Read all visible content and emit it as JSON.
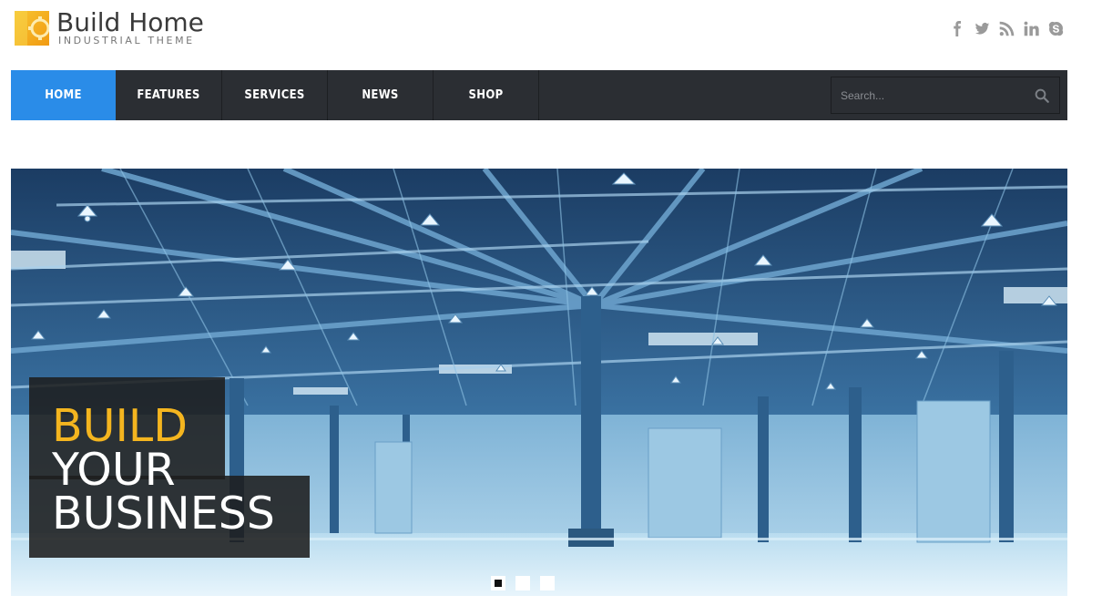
{
  "brand": {
    "title": "Build Home",
    "subtitle": "INDUSTRIAL THEME",
    "accent": "#f4b51f"
  },
  "social": [
    {
      "icon": "facebook-icon"
    },
    {
      "icon": "twitter-icon"
    },
    {
      "icon": "rss-icon"
    },
    {
      "icon": "linkedin-icon"
    },
    {
      "icon": "skype-icon"
    }
  ],
  "nav": {
    "items": [
      {
        "label": "HOME",
        "active": true
      },
      {
        "label": "FEATURES",
        "active": false
      },
      {
        "label": "SERVICES",
        "active": false
      },
      {
        "label": "NEWS",
        "active": false
      },
      {
        "label": "SHOP",
        "active": false
      }
    ],
    "active_color": "#2a8ce8",
    "search": {
      "placeholder": "Search...",
      "value": "",
      "icon": "search-icon"
    }
  },
  "hero": {
    "caption": {
      "line1": "BUILD",
      "line2": "YOUR",
      "line3": "BUSINESS"
    },
    "slides_count": 3,
    "active_slide": 1
  }
}
